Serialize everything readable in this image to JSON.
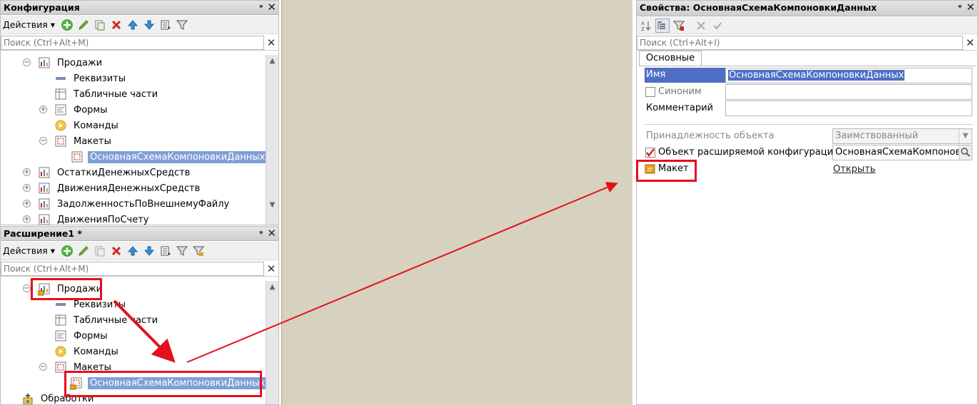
{
  "config": {
    "title": "Конфигурация",
    "actions": "Действия",
    "search_placeholder": "Поиск (Ctrl+Alt+M)",
    "tree": [
      {
        "label": "Продажи",
        "exp": "⊖",
        "icon": "document-icon"
      },
      {
        "label": "Реквизиты",
        "icon": "attribute-icon"
      },
      {
        "label": "Табличные части",
        "icon": "table-icon"
      },
      {
        "label": "Формы",
        "exp": "⊕",
        "icon": "form-icon"
      },
      {
        "label": "Команды",
        "icon": "command-icon"
      },
      {
        "label": "Макеты",
        "exp": "⊖",
        "icon": "template-icon"
      },
      {
        "label": "ОсновнаяСхемаКомпоновкиДанных",
        "icon": "layout-icon",
        "selected": true
      },
      {
        "label": "ОстаткиДенежныхСредств",
        "exp": "⊕",
        "icon": "register-icon"
      },
      {
        "label": "ДвиженияДенежныхСредств",
        "exp": "⊕",
        "icon": "register-icon"
      },
      {
        "label": "ЗадолженностьПоВнешнемуФайлу",
        "exp": "⊕",
        "icon": "register-icon"
      },
      {
        "label": "ДвиженияПоСчету",
        "exp": "⊕",
        "icon": "register-icon"
      }
    ]
  },
  "extension": {
    "title": "Расширение1 *",
    "actions": "Действия",
    "search_placeholder": "Поиск (Ctrl+Alt+M)",
    "tree": [
      {
        "label": "Продажи",
        "exp": "⊖",
        "icon": "borrowed-document-icon"
      },
      {
        "label": "Реквизиты",
        "icon": "attribute-icon"
      },
      {
        "label": "Табличные части",
        "icon": "table-icon"
      },
      {
        "label": "Формы",
        "icon": "form-icon"
      },
      {
        "label": "Команды",
        "icon": "command-icon"
      },
      {
        "label": "Макеты",
        "exp": "⊖",
        "icon": "template-icon"
      },
      {
        "label": "ОсновнаяСхемаКомпоновкиДанных",
        "icon": "borrowed-layout-icon",
        "selected": true
      },
      {
        "label": "Обработки",
        "exp": "⊕",
        "icon": "processing-icon"
      }
    ]
  },
  "properties": {
    "title": "Свойства: ОсновнаяСхемаКомпоновкиДанных",
    "search_placeholder": "Поиск (Ctrl+Alt+I)",
    "tab": "Основные",
    "name_label": "Имя",
    "name_value": "ОсновнаяСхемаКомпоновкиДанных",
    "synonym_label": "Синоним",
    "synonym_value": "",
    "comment_label": "Комментарий",
    "comment_value": "",
    "belonging_label": "Принадлежность объекта",
    "belonging_value": "Заимствованный",
    "ext_object_label": "Объект расширяемой конфигурации",
    "ext_object_value": "ОсновнаяСхемаКомпоновкиДанных",
    "template_label": "Макет",
    "template_link": "Открыть"
  },
  "colors": {
    "selection": "#7f9fd6",
    "annotation": "#e4101d",
    "center_bg": "#d6d2bf"
  }
}
